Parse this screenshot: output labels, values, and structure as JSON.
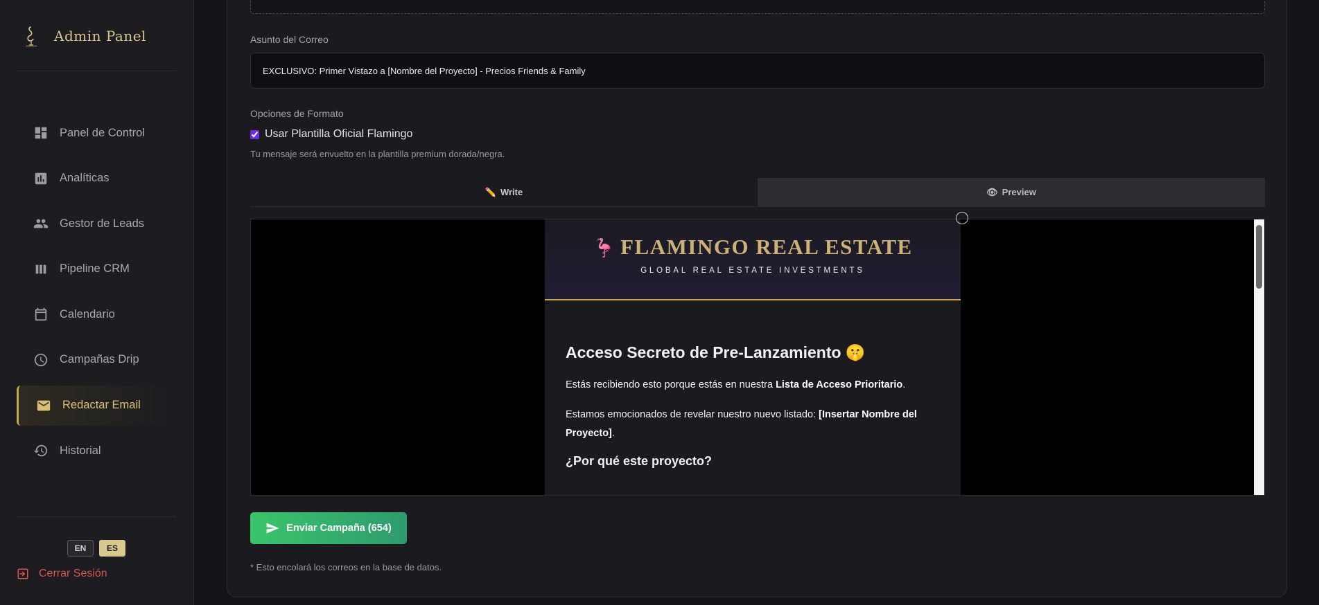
{
  "sidebar": {
    "title": "Admin Panel",
    "nav": [
      {
        "label": "Panel de Control",
        "icon": "dashboard-icon"
      },
      {
        "label": "Analíticas",
        "icon": "analytics-icon"
      },
      {
        "label": "Gestor de Leads",
        "icon": "people-icon"
      },
      {
        "label": "Pipeline CRM",
        "icon": "columns-icon"
      },
      {
        "label": "Calendario",
        "icon": "calendar-icon"
      },
      {
        "label": "Campañas Drip",
        "icon": "clock-icon"
      },
      {
        "label": "Redactar Email",
        "icon": "mail-icon",
        "active": true
      },
      {
        "label": "Historial",
        "icon": "history-icon"
      }
    ],
    "lang": {
      "en": "EN",
      "es": "ES",
      "selected": "ES"
    },
    "logout": "Cerrar Sesión"
  },
  "form": {
    "subject_label": "Asunto del Correo",
    "subject_value": "EXCLUSIVO: Primer Vistazo a [Nombre del Proyecto] - Precios Friends & Family",
    "format_label": "Opciones de Formato",
    "template_checkbox_label": "Usar Plantilla Oficial Flamingo",
    "template_checked": true,
    "template_hint": "Tu mensaje será envuelto en la plantilla premium dorada/negra.",
    "tabs": {
      "write": "Write",
      "preview": "Preview",
      "active": "preview"
    },
    "send_label": "Enviar Campaña (654)",
    "footnote": "* Esto encolará los correos en la base de datos."
  },
  "preview": {
    "brand": "FLAMINGO REAL ESTATE",
    "tagline": "GLOBAL REAL ESTATE INVESTMENTS",
    "heading": "Acceso Secreto de Pre-Lanzamiento 🤫",
    "p1_before": "Estás recibiendo esto porque estás en nuestra ",
    "p1_bold": "Lista de Acceso Prioritario",
    "p1_after": ".",
    "p2_before": "Estamos emocionados de revelar nuestro nuevo listado: ",
    "p2_bold": "[Insertar Nombre del Proyecto]",
    "p2_after": ".",
    "subheading": "¿Por qué este proyecto?"
  },
  "colors": {
    "accent_gold": "#c9a74c",
    "send_green": "#3bc46a",
    "logout_red": "#d9534f"
  }
}
